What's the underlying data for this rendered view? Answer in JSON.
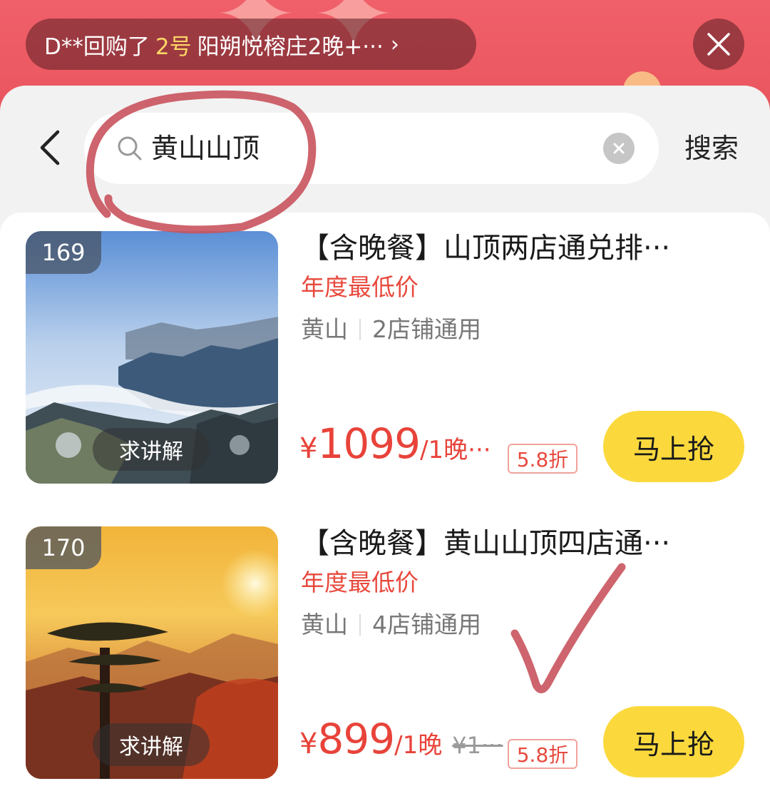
{
  "banner": {
    "ticker": {
      "prefix": "D**回购了",
      "highlight": "2号",
      "suffix": "阳朔悦榕庄2晚+···",
      "arrow": "›"
    }
  },
  "search": {
    "back_icon": "chevron-left-icon",
    "query": "黄山山顶",
    "submit_label": "搜索"
  },
  "results": [
    {
      "rank": "169",
      "explain_label": "求讲解",
      "title": "【含晚餐】山顶两店通兑排···",
      "tag": "年度最低价",
      "location": "黄山",
      "stores": "2店铺通用",
      "currency": "¥",
      "price": "1099",
      "unit": "/1晚···",
      "original_price": "",
      "discount": "5.8折",
      "buy_label": "马上抢",
      "thumb_scene": "sea-of-clouds"
    },
    {
      "rank": "170",
      "explain_label": "求讲解",
      "title": "【含晚餐】黄山山顶四店通···",
      "tag": "年度最低价",
      "location": "黄山",
      "stores": "4店铺通用",
      "currency": "¥",
      "price": "899",
      "unit": "/1晚",
      "original_price": "¥1···",
      "discount": "5.8折",
      "buy_label": "马上抢",
      "thumb_scene": "sunset-pine"
    }
  ],
  "colors": {
    "accent_red": "#e8433a",
    "buy_yellow": "#fbd93d",
    "annotation_red": "#c9535d"
  }
}
